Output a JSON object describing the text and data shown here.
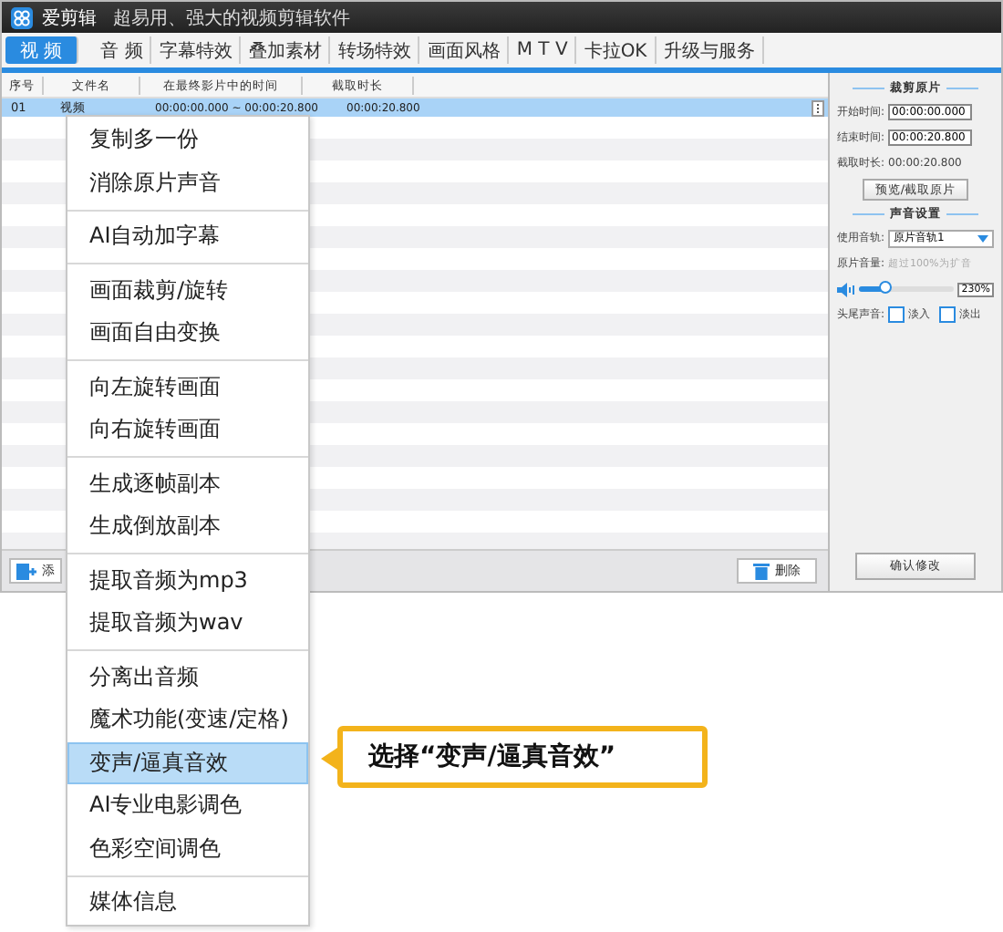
{
  "window": {
    "title": "爱剪辑",
    "subtitle": "超易用、强大的视频剪辑软件"
  },
  "tabs": [
    {
      "label": "视 频",
      "selected": true
    },
    {
      "label": "音 频",
      "selected": false
    },
    {
      "label": "字幕特效",
      "selected": false
    },
    {
      "label": "叠加素材",
      "selected": false
    },
    {
      "label": "转场特效",
      "selected": false
    },
    {
      "label": "画面风格",
      "selected": false
    },
    {
      "label": "M T V",
      "selected": false
    },
    {
      "label": "卡拉OK",
      "selected": false
    },
    {
      "label": "升级与服务",
      "selected": false
    }
  ],
  "table": {
    "columns": [
      "序号",
      "文件名",
      "在最终影片中的时间",
      "截取时长"
    ],
    "rows": [
      {
        "cells": [
          "01",
          "视频",
          "00:00:00.000 ~ 00:00:20.800",
          "00:00:20.800"
        ],
        "selected": true
      }
    ]
  },
  "bottom_bar": {
    "add_button": "添",
    "delete_button": "删除"
  },
  "trim_panel": {
    "heading": "裁剪原片",
    "start_label": "开始时间:",
    "start_value": "00:00:00.000",
    "end_label": "结束时间:",
    "end_value": "00:00:20.800",
    "duration_label": "截取时长:",
    "duration_value": "00:00:20.800",
    "preview_button": "预览/截取原片"
  },
  "sound_panel": {
    "heading": "声音设置",
    "track_label": "使用音轨:",
    "track_value": "原片音轨1",
    "volume_label": "原片音量:",
    "volume_hint": "超过100%为扩音",
    "volume": {
      "level": 0.28,
      "reading": "230%"
    },
    "fade_label": "头尾声音:",
    "fades": [
      {
        "label": "淡入",
        "checked": false
      },
      {
        "label": "淡出",
        "checked": false
      }
    ],
    "confirm_button": "确认修改"
  },
  "context_menu": [
    [
      {
        "label": "复制多一份",
        "selected": false
      },
      {
        "label": "消除原片声音",
        "selected": false
      }
    ],
    [
      {
        "label": "AI自动加字幕",
        "selected": false
      }
    ],
    [
      {
        "label": "画面裁剪/旋转",
        "selected": false
      },
      {
        "label": "画面自由变换",
        "selected": false
      }
    ],
    [
      {
        "label": "向左旋转画面",
        "selected": false
      },
      {
        "label": "向右旋转画面",
        "selected": false
      }
    ],
    [
      {
        "label": "生成逐帧副本",
        "selected": false
      },
      {
        "label": "生成倒放副本",
        "selected": false
      }
    ],
    [
      {
        "label": "提取音频为mp3",
        "selected": false
      },
      {
        "label": "提取音频为wav",
        "selected": false
      }
    ],
    [
      {
        "label": "分离出音频",
        "selected": false
      },
      {
        "label": "魔术功能(变速/定格)",
        "selected": false
      },
      {
        "label": "变声/逼真音效",
        "selected": true
      },
      {
        "label": "AI专业电影调色",
        "selected": false
      },
      {
        "label": "色彩空间调色",
        "selected": false
      }
    ],
    [
      {
        "label": "媒体信息",
        "selected": false
      }
    ]
  ],
  "callout": "选择“变声/逼真音效”"
}
